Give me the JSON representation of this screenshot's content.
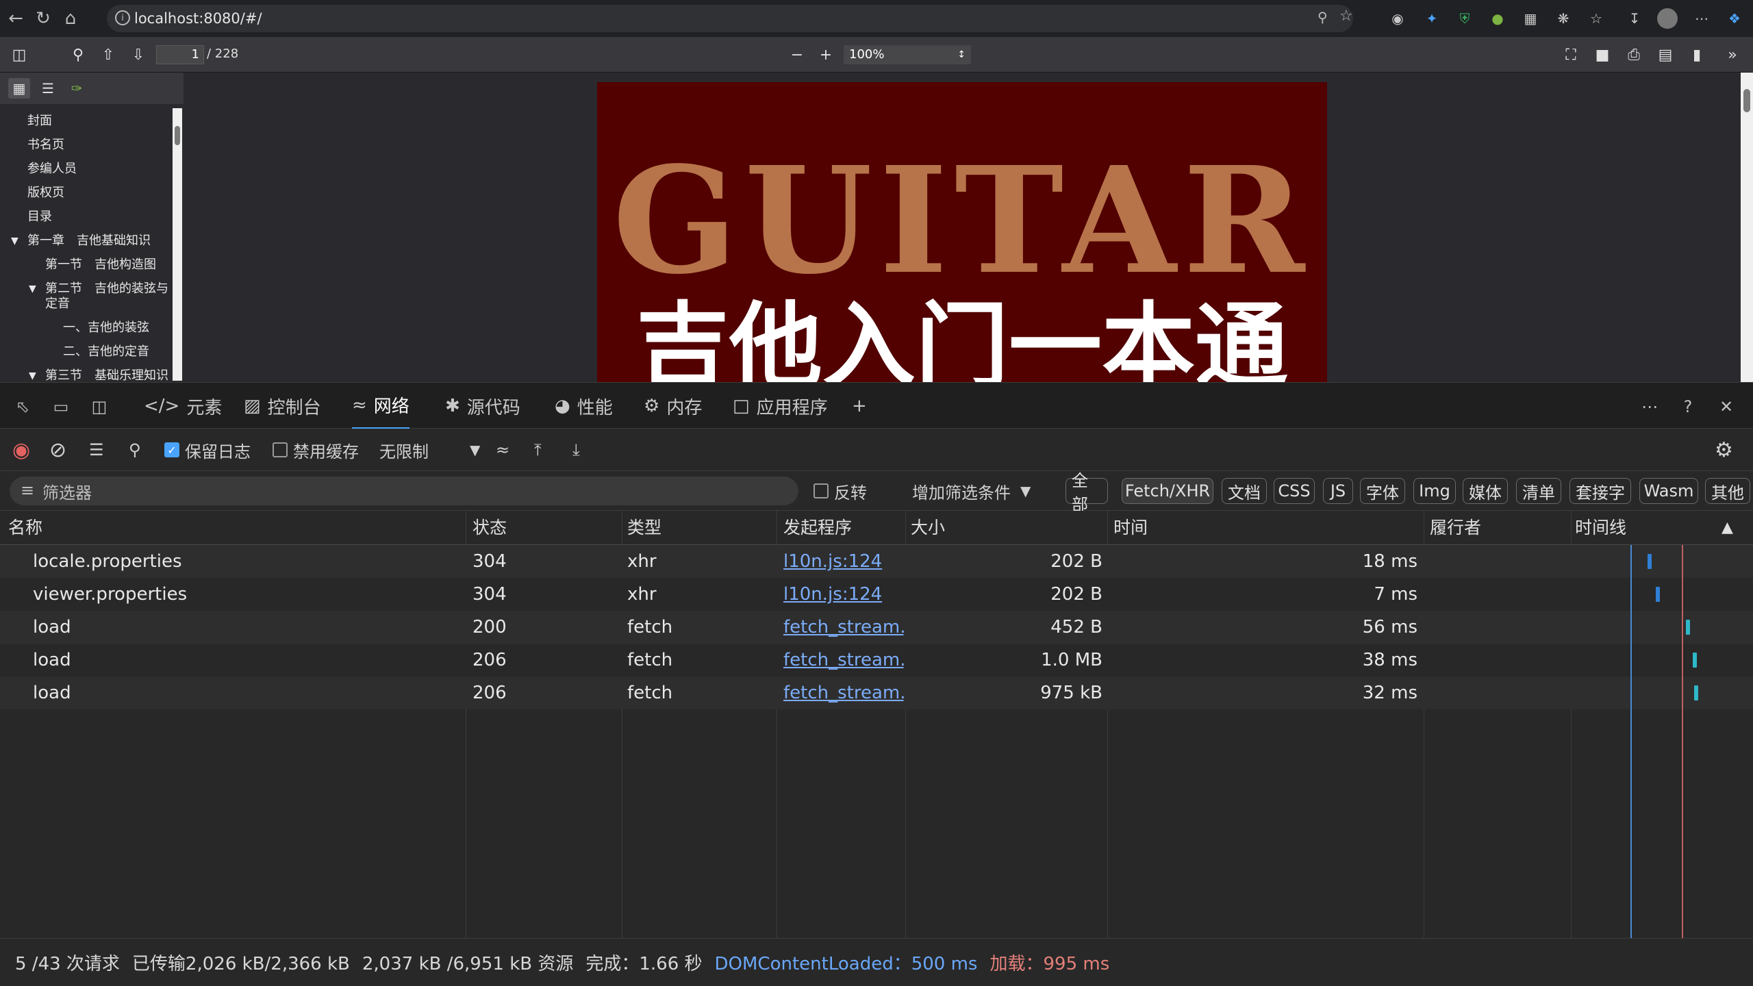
{
  "browser": {
    "url": "localhost:8080/#/"
  },
  "pdf": {
    "page_current": "1",
    "page_total": "/ 228",
    "zoom": "100%",
    "outline": [
      {
        "label": "封面"
      },
      {
        "label": "书名页"
      },
      {
        "label": "参编人员"
      },
      {
        "label": "版权页"
      },
      {
        "label": "目录"
      },
      {
        "label": "第一章　吉他基础知识"
      },
      {
        "label": "第一节　吉他构造图"
      },
      {
        "label": "第二节　吉他的装弦与"
      },
      {
        "label": "定音"
      },
      {
        "label": "一、吉他的装弦"
      },
      {
        "label": "二、吉他的定音"
      },
      {
        "label": "第三节　基础乐理知识"
      }
    ],
    "cover_title_en": "GUITAR",
    "cover_title_zh": "吉他入门一本通"
  },
  "devtools": {
    "tabs": [
      {
        "label": "元素"
      },
      {
        "label": "控制台"
      },
      {
        "label": "网络"
      },
      {
        "label": "源代码"
      },
      {
        "label": "性能"
      },
      {
        "label": "内存"
      },
      {
        "label": "应用程序"
      }
    ],
    "toolbar": {
      "preserve_log": "保留日志",
      "disable_cache": "禁用缓存",
      "throttle": "无限制"
    },
    "filter": {
      "placeholder": "筛选器",
      "invert": "反转",
      "more_filters": "增加筛选条件",
      "types": [
        "全部",
        "Fetch/XHR",
        "文档",
        "CSS",
        "JS",
        "字体",
        "Img",
        "媒体",
        "清单",
        "套接字",
        "Wasm",
        "其他"
      ]
    },
    "columns": [
      "名称",
      "状态",
      "类型",
      "发起程序",
      "大小",
      "时间",
      "履行者",
      "时间线"
    ],
    "rows": [
      {
        "name": "locale.properties",
        "status": "304",
        "type": "xhr",
        "initiator": "l10n.js:124",
        "size": "202 B",
        "time": "18 ms"
      },
      {
        "name": "viewer.properties",
        "status": "304",
        "type": "xhr",
        "initiator": "l10n.js:124",
        "size": "202 B",
        "time": "7 ms"
      },
      {
        "name": "load",
        "status": "200",
        "type": "fetch",
        "initiator": "fetch_stream.js:",
        "size": "452 B",
        "time": "56 ms"
      },
      {
        "name": "load",
        "status": "206",
        "type": "fetch",
        "initiator": "fetch_stream.js:",
        "size": "1.0 MB",
        "time": "38 ms"
      },
      {
        "name": "load",
        "status": "206",
        "type": "fetch",
        "initiator": "fetch_stream.js:",
        "size": "975 kB",
        "time": "32 ms"
      }
    ],
    "status": {
      "requests": "5 /43 次请求",
      "transferred": "已传输2,026 kB/2,366 kB",
      "resources": "2,037 kB /6,951 kB 资源",
      "finish": "完成：1.66 秒",
      "dcl": "DOMContentLoaded：500 ms",
      "load": "加载：995 ms"
    }
  },
  "colors": {
    "accent": "#4aa3ff",
    "link": "#7cacf8",
    "cover_bg": "#520000",
    "cover_title": "#b7734a"
  }
}
